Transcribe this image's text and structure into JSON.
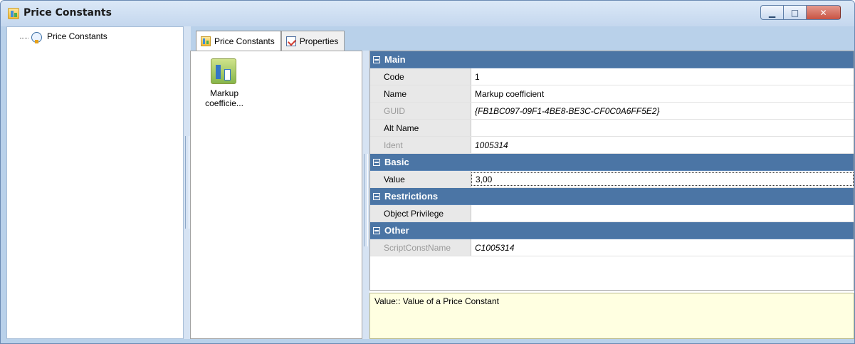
{
  "window": {
    "title": "Price Constants",
    "minimize_glyph": "▁",
    "maximize_glyph": "□",
    "close_glyph": "✕"
  },
  "tree": {
    "root_label": "Price Constants"
  },
  "tabs": [
    {
      "label": "Price Constants",
      "icon": "price-constants-icon",
      "active": true
    },
    {
      "label": "Properties",
      "icon": "properties-icon",
      "active": false
    }
  ],
  "items": [
    {
      "caption_line1": "Markup",
      "caption_line2": "coefficie..."
    }
  ],
  "property_grid": {
    "categories": [
      {
        "name": "Main",
        "rows": [
          {
            "name": "Code",
            "value": "1",
            "disabled": false,
            "italic": false
          },
          {
            "name": "Name",
            "value": "Markup coefficient",
            "disabled": false,
            "italic": false
          },
          {
            "name": "GUID",
            "value": "{FB1BC097-09F1-4BE8-BE3C-CF0C0A6FF5E2}",
            "disabled": true,
            "italic": true
          },
          {
            "name": "Alt Name",
            "value": "",
            "disabled": false,
            "italic": false
          },
          {
            "name": "Ident",
            "value": "1005314",
            "disabled": true,
            "italic": true
          }
        ]
      },
      {
        "name": "Basic",
        "rows": [
          {
            "name": "Value",
            "value": "3,00",
            "disabled": false,
            "italic": false
          }
        ]
      },
      {
        "name": "Restrictions",
        "rows": [
          {
            "name": "Object Privilege",
            "value": "",
            "disabled": false,
            "italic": false
          }
        ]
      },
      {
        "name": "Other",
        "rows": [
          {
            "name": "ScriptConstName",
            "value": "C1005314",
            "disabled": true,
            "italic": true
          }
        ]
      }
    ]
  },
  "description": {
    "text": "Value:: Value of a Price Constant"
  }
}
